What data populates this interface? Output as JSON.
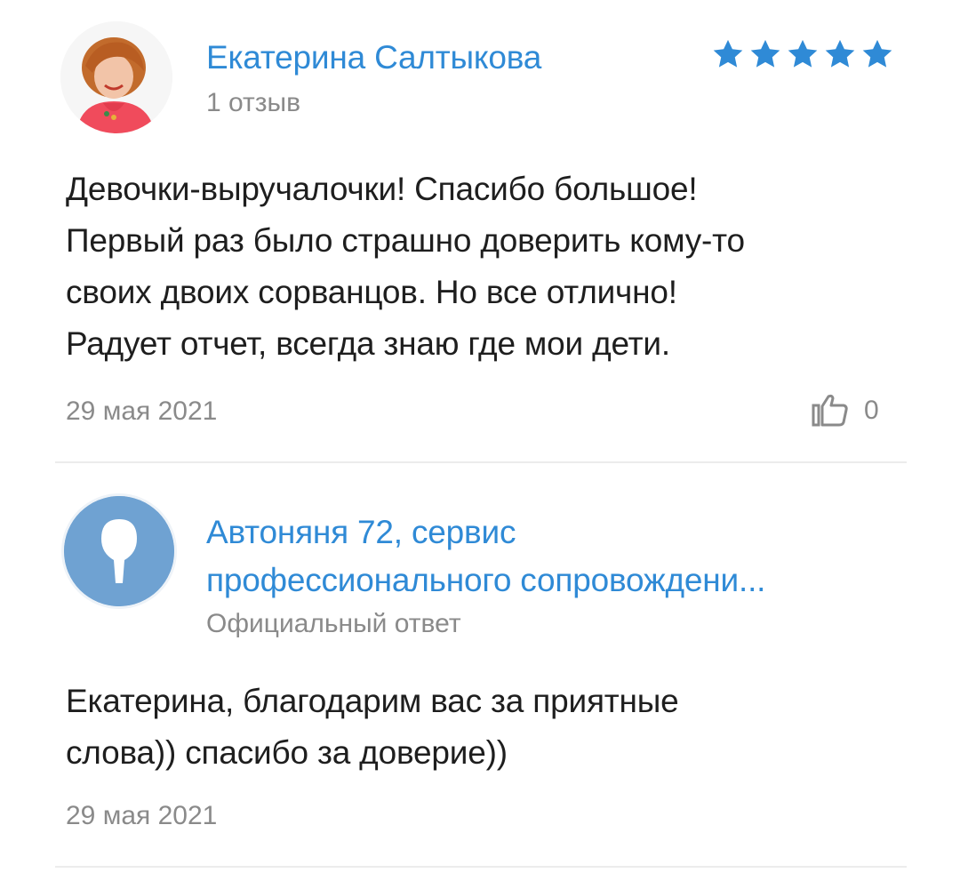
{
  "reviews": [
    {
      "author": "Екатерина Салтыкова",
      "author_meta": "1 отзыв",
      "rating": 5,
      "rating_color": "#2f8ad6",
      "text_lines": [
        "Девочки-выручалочки! Спасибо большое!",
        "Первый раз было страшно доверить кому-то",
        "своих двоих сорванцов. Но все отлично!",
        "Радует отчет, всегда знаю где мои дети."
      ],
      "date": "29 мая 2021",
      "likes": "0",
      "like_icon": "thumbs-up-icon"
    }
  ],
  "reply": {
    "author_line1": "Автоняня 72, сервис",
    "author_line2": "профессионального сопровождени...",
    "author_meta": "Официальный ответ",
    "avatar_icon": "pin-placeholder-icon",
    "avatar_color": "#6fa2d2",
    "text_lines": [
      "Екатерина, благодарим вас за приятные",
      "слова)) спасибо за доверие))"
    ],
    "date": "29 мая 2021"
  }
}
